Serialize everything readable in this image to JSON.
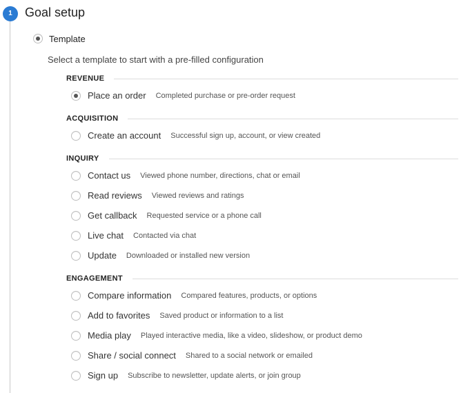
{
  "header": {
    "step_number": "1",
    "title": "Goal setup"
  },
  "template_option": {
    "label": "Template",
    "selected": true
  },
  "description": "Select a template to start with a pre-filled configuration",
  "categories": [
    {
      "label": "REVENUE",
      "options": [
        {
          "label": "Place an order",
          "desc": "Completed purchase or pre-order request",
          "selected": true
        }
      ]
    },
    {
      "label": "ACQUISITION",
      "options": [
        {
          "label": "Create an account",
          "desc": "Successful sign up, account, or view created",
          "selected": false
        }
      ]
    },
    {
      "label": "INQUIRY",
      "options": [
        {
          "label": "Contact us",
          "desc": "Viewed phone number, directions, chat or email",
          "selected": false
        },
        {
          "label": "Read reviews",
          "desc": "Viewed reviews and ratings",
          "selected": false
        },
        {
          "label": "Get callback",
          "desc": "Requested service or a phone call",
          "selected": false
        },
        {
          "label": "Live chat",
          "desc": "Contacted via chat",
          "selected": false
        },
        {
          "label": "Update",
          "desc": "Downloaded or installed new version",
          "selected": false
        }
      ]
    },
    {
      "label": "ENGAGEMENT",
      "options": [
        {
          "label": "Compare information",
          "desc": "Compared features, products, or options",
          "selected": false
        },
        {
          "label": "Add to favorites",
          "desc": "Saved product or information to a list",
          "selected": false
        },
        {
          "label": "Media play",
          "desc": "Played interactive media, like a video, slideshow, or product demo",
          "selected": false
        },
        {
          "label": "Share / social connect",
          "desc": "Shared to a social network or emailed",
          "selected": false
        },
        {
          "label": "Sign up",
          "desc": "Subscribe to newsletter, update alerts, or join group",
          "selected": false
        }
      ]
    }
  ]
}
